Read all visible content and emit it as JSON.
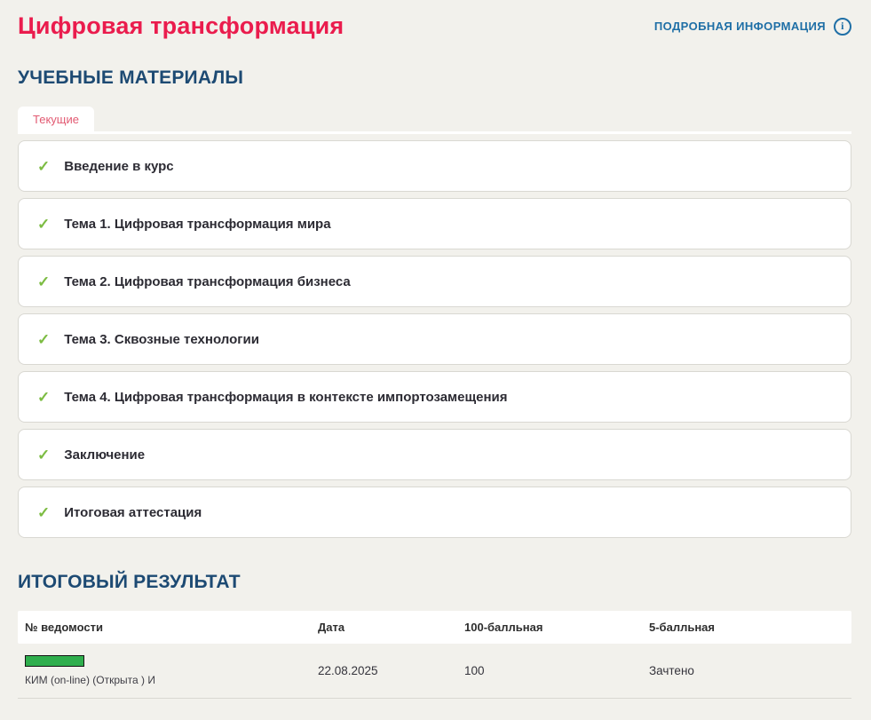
{
  "header": {
    "title": "Цифровая трансформация",
    "details_link": "ПОДРОБНАЯ ИНФОРМАЦИЯ"
  },
  "materials": {
    "heading": "УЧЕБНЫЕ МАТЕРИАЛЫ",
    "active_tab": "Текущие",
    "items": [
      {
        "label": "Введение в курс",
        "completed": true
      },
      {
        "label": "Тема 1. Цифровая трансформация мира",
        "completed": true
      },
      {
        "label": "Тема 2. Цифровая трансформация бизнеса",
        "completed": true
      },
      {
        "label": "Тема 3. Сквозные технологии",
        "completed": true
      },
      {
        "label": "Тема 4. Цифровая трансформация в контексте импортозамещения",
        "completed": true
      },
      {
        "label": "Заключение",
        "completed": true
      },
      {
        "label": "Итоговая аттестация",
        "completed": true
      }
    ]
  },
  "results": {
    "heading": "ИТОГОВЫЙ РЕЗУЛЬТАТ",
    "columns": {
      "statement": "№ ведомости",
      "date": "Дата",
      "scale100": "100-балльная",
      "scale5": "5-балльная"
    },
    "rows": [
      {
        "statement": "КИМ (on-line) (Открыта ) И",
        "date": "22.08.2025",
        "scale100": "100",
        "scale5": "Зачтено"
      }
    ]
  },
  "icons": {
    "check": "✓",
    "info": "i"
  },
  "colors": {
    "accent_red": "#ea1c4d",
    "tab_red": "#e25a72",
    "heading_navy": "#1d4a73",
    "link_blue": "#1f6fa6",
    "check_green": "#7cbc42",
    "bar_green": "#2fae4d",
    "page_background": "#f2f1ec"
  }
}
